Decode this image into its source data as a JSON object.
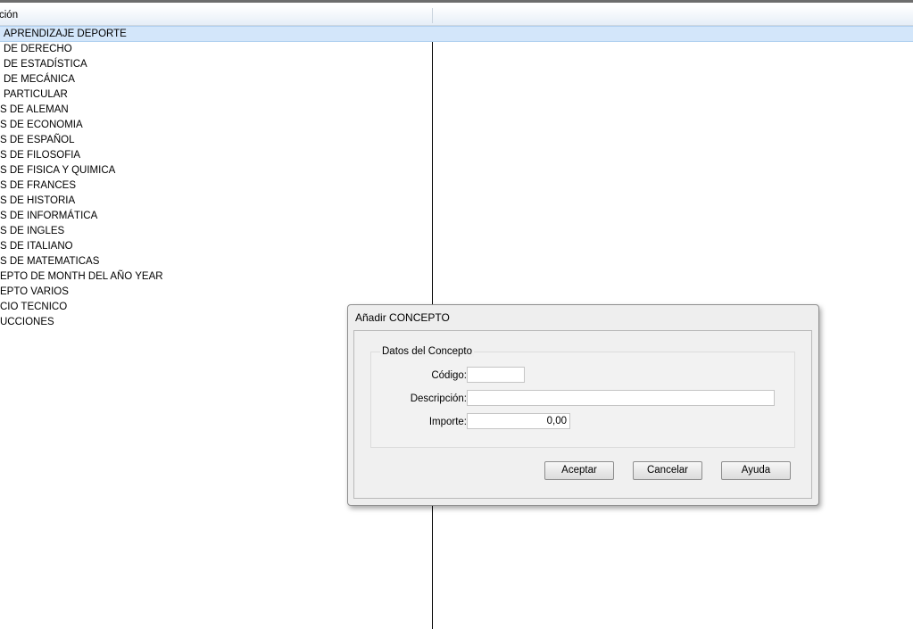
{
  "table": {
    "header": {
      "col1": "ción",
      "col2": ""
    },
    "rows": [
      {
        "label": "APRENDIZAJE DEPORTE",
        "selected": true
      },
      {
        "label": "DE DERECHO"
      },
      {
        "label": "DE ESTADÍSTICA"
      },
      {
        "label": "DE MECÁNICA"
      },
      {
        "label": "PARTICULAR"
      },
      {
        "label": "S DE ALEMAN"
      },
      {
        "label": "S DE ECONOMIA"
      },
      {
        "label": "S DE ESPAÑOL"
      },
      {
        "label": "S DE FILOSOFIA"
      },
      {
        "label": "S DE FISICA Y QUIMICA"
      },
      {
        "label": "S DE FRANCES"
      },
      {
        "label": "S DE HISTORIA"
      },
      {
        "label": "S DE INFORMÁTICA"
      },
      {
        "label": "S DE INGLES"
      },
      {
        "label": "S DE ITALIANO"
      },
      {
        "label": "S DE MATEMATICAS"
      },
      {
        "label": "EPTO DE MONTH DEL AÑO YEAR"
      },
      {
        "label": "EPTO VARIOS"
      },
      {
        "label": "CIO TECNICO"
      },
      {
        "label": "UCCIONES"
      }
    ]
  },
  "dialog": {
    "title": "Añadir CONCEPTO",
    "group_title": "Datos del Concepto",
    "fields": {
      "codigo": {
        "label": "Código:",
        "value": ""
      },
      "descripcion": {
        "label": "Descripción:",
        "value": ""
      },
      "importe": {
        "label": "Importe:",
        "value": "0,00"
      }
    },
    "buttons": {
      "accept": "Aceptar",
      "cancel": "Cancelar",
      "help": "Ayuda"
    }
  },
  "colors": {
    "selected_row": "#d3e6fa",
    "dialog_bg": "#eeeeee"
  }
}
